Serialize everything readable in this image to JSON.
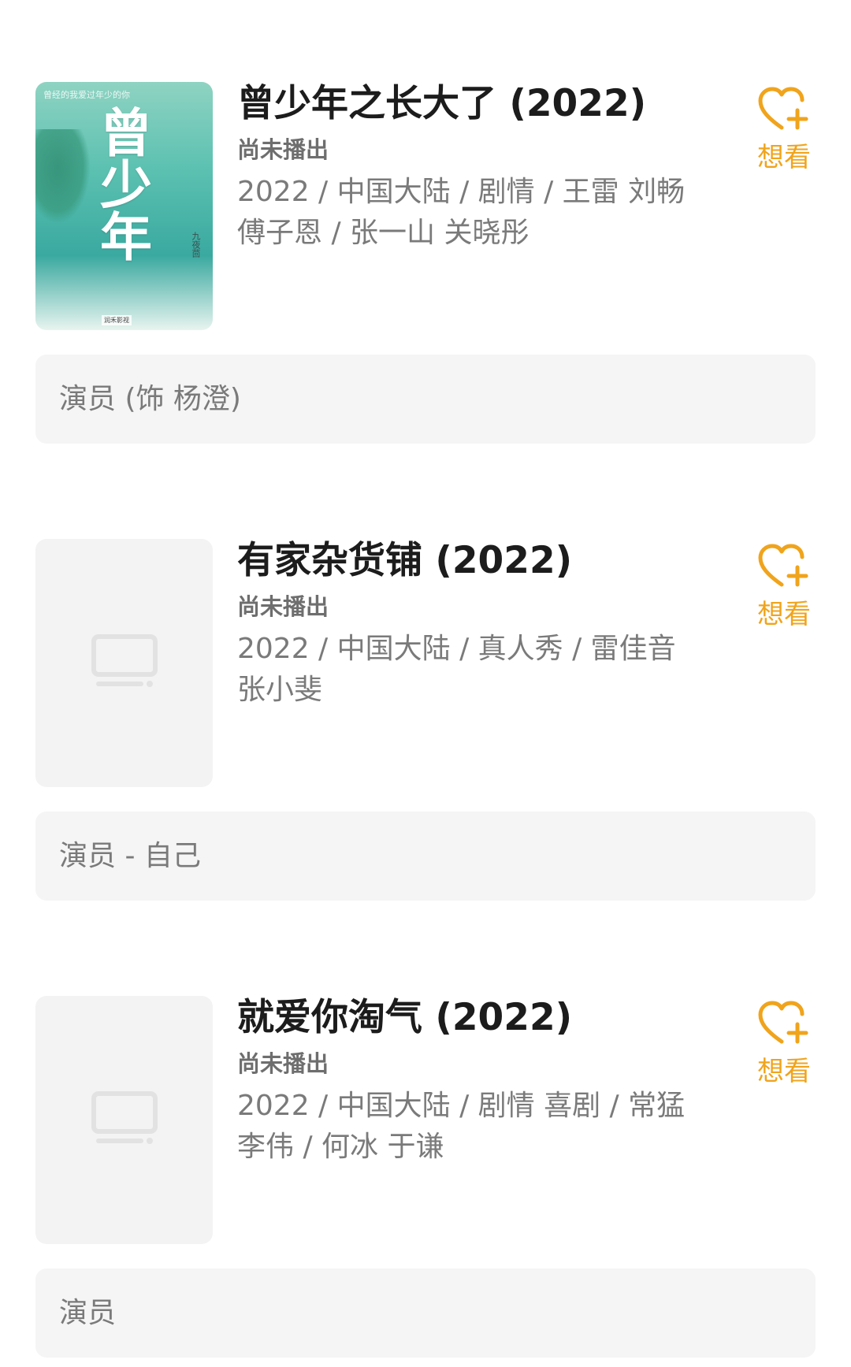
{
  "items": [
    {
      "title": "曾少年之长大了 (2022)",
      "status": "尚未播出",
      "meta": "2022 / 中国大陆 / 剧情 / 王雷 刘畅 傅子恩 / 张一山 关晓彤",
      "want_label": "想看",
      "role": "演员 (饰 杨澄)",
      "poster": {
        "type": "image",
        "top_text": "曾经的我爱过年少的你",
        "title_text": "曾少年",
        "author_text": "九夜茴",
        "logo_text": "润禾影视"
      }
    },
    {
      "title": "有家杂货铺 (2022)",
      "status": "尚未播出",
      "meta": "2022 / 中国大陆 / 真人秀 / 雷佳音 张小斐",
      "want_label": "想看",
      "role": "演员 - 自己",
      "poster": {
        "type": "placeholder",
        "icon": "tv-icon"
      }
    },
    {
      "title": "就爱你淘气 (2022)",
      "status": "尚未播出",
      "meta": "2022 / 中国大陆 / 剧情 喜剧 / 常猛 李伟 / 何冰 于谦",
      "want_label": "想看",
      "role": "演员",
      "poster": {
        "type": "placeholder",
        "icon": "tv-icon"
      }
    }
  ],
  "colors": {
    "accent": "#f0a41c",
    "title": "#1c1c1c",
    "secondary": "#7a7a7a",
    "card_bg": "#f5f5f5",
    "placeholder_bg": "#f3f3f3"
  }
}
